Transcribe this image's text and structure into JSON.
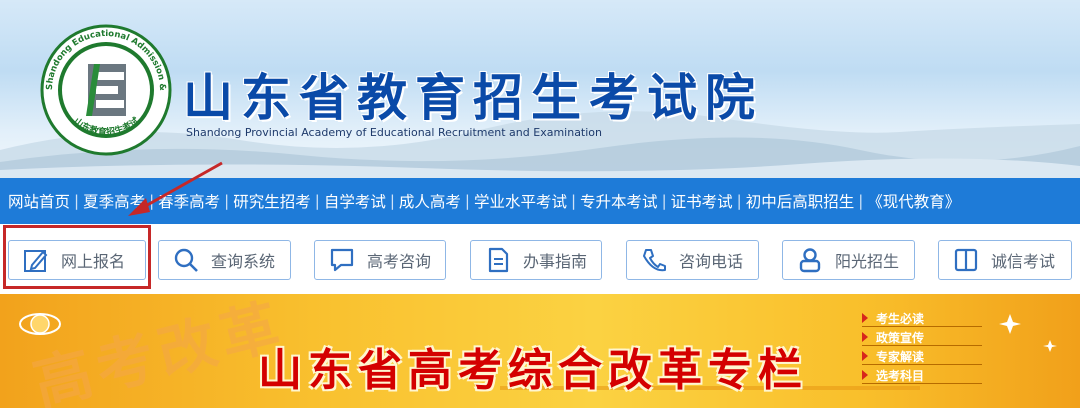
{
  "header": {
    "title": "山东省教育招生考试院",
    "subtitle": "Shandong Provincial Academy of Educational Recruitment and Examination",
    "logo_ring_text": "Shandong Educational Admission & Examinations",
    "logo_bottom_text": "山东教育招生考试",
    "colors": {
      "title": "#0a4aa8",
      "nav": "#1e7bd8"
    }
  },
  "nav": {
    "items": [
      "网站首页",
      "夏季高考",
      "春季高考",
      "研究生招考",
      "自学考试",
      "成人高考",
      "学业水平考试",
      "专升本考试",
      "证书考试",
      "初中后高职招生",
      "《现代教育》"
    ]
  },
  "quick_entry": {
    "items": [
      {
        "label": "网上报名",
        "icon": "pencil-icon"
      },
      {
        "label": "查询系统",
        "icon": "search-icon"
      },
      {
        "label": "高考咨询",
        "icon": "chat-icon"
      },
      {
        "label": "办事指南",
        "icon": "document-icon"
      },
      {
        "label": "咨询电话",
        "icon": "phone-icon"
      },
      {
        "label": "阳光招生",
        "icon": "person-icon"
      },
      {
        "label": "诚信考试",
        "icon": "book-icon"
      }
    ],
    "highlight_color": "#c62828"
  },
  "banner": {
    "title": "山东省高考综合改革专栏",
    "watermark": "高考改革",
    "links": [
      "考生必读",
      "政策宣传",
      "专家解读",
      "选考科目"
    ],
    "title_color": "#d40000"
  }
}
